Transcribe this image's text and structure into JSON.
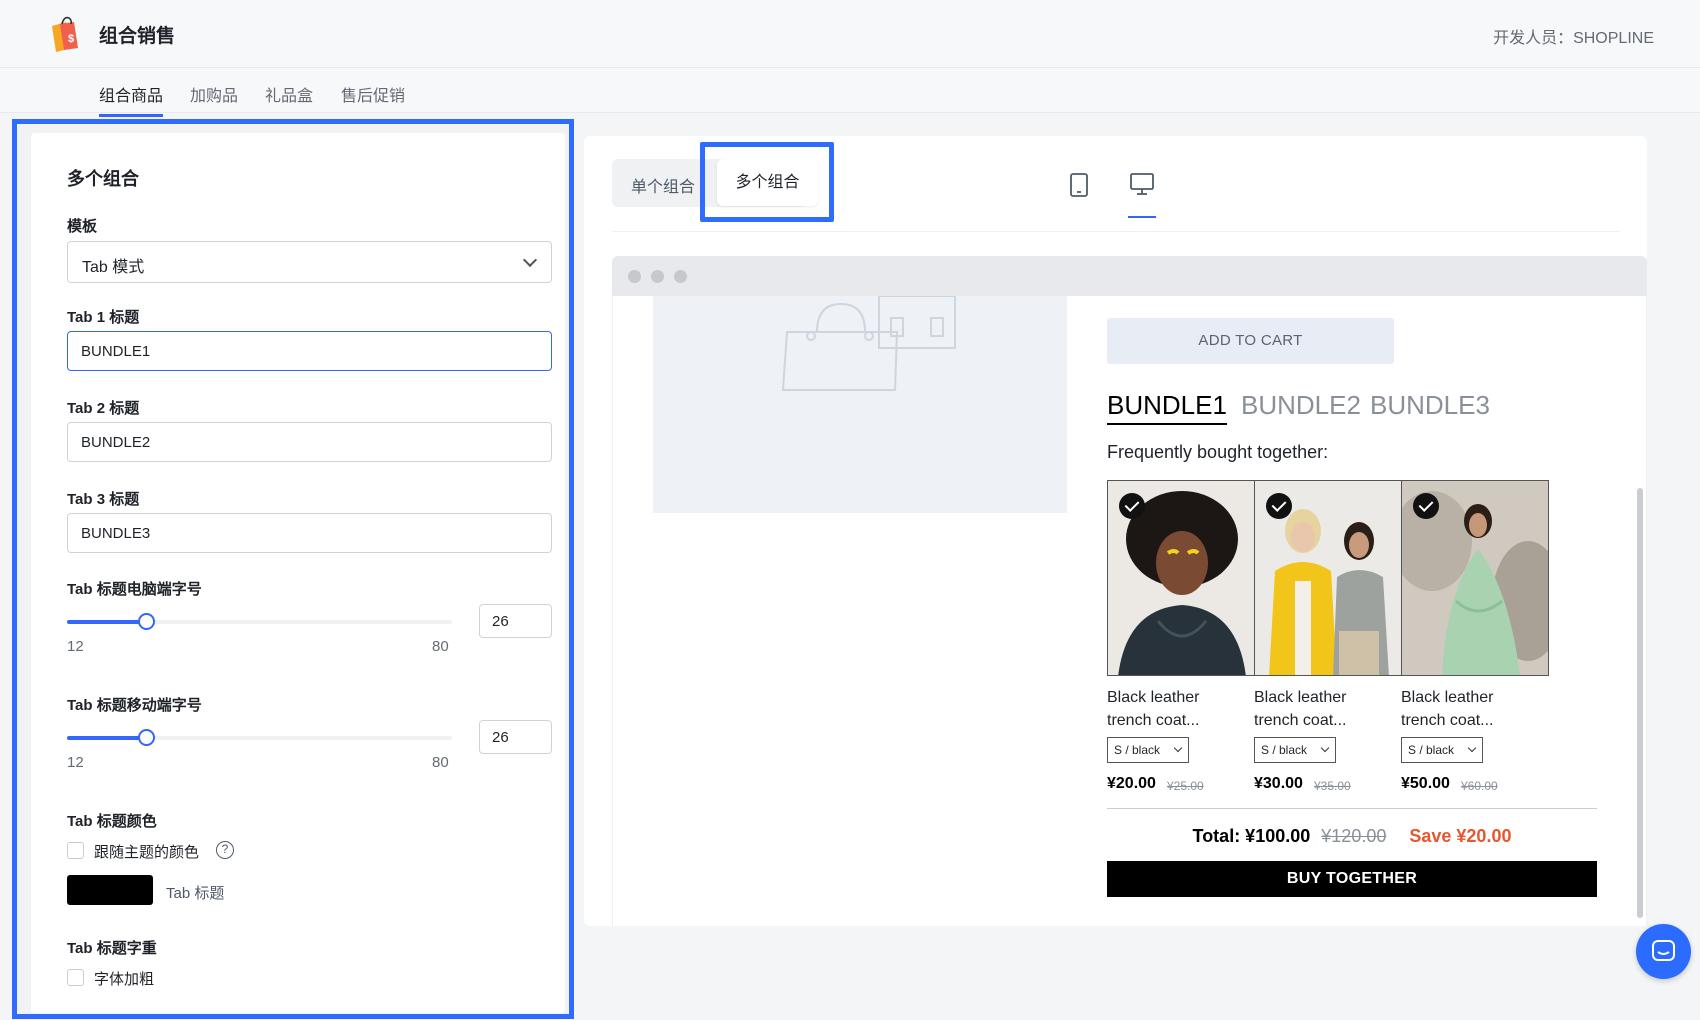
{
  "header": {
    "app_title": "组合销售",
    "developer": "开发人员：SHOPLINE"
  },
  "nav": {
    "tabs": [
      {
        "label": "组合商品",
        "active": true
      },
      {
        "label": "加购品",
        "active": false
      },
      {
        "label": "礼品盒",
        "active": false
      },
      {
        "label": "售后促销",
        "active": false
      }
    ]
  },
  "settings": {
    "title": "多个组合",
    "template": {
      "label": "模板",
      "value": "Tab 模式"
    },
    "tab1": {
      "label": "Tab 1 标题",
      "value": "BUNDLE1"
    },
    "tab2": {
      "label": "Tab 2 标题",
      "value": "BUNDLE2"
    },
    "tab3": {
      "label": "Tab 3 标题",
      "value": "BUNDLE3"
    },
    "desktop_size": {
      "label": "Tab 标题电脑端字号",
      "min": "12",
      "max": "80",
      "value": "26"
    },
    "mobile_size": {
      "label": "Tab 标题移动端字号",
      "min": "12",
      "max": "80",
      "value": "26"
    },
    "color": {
      "label": "Tab 标题颜色",
      "follow_theme_label": "跟随主题的颜色",
      "swatch_label": "Tab 标题",
      "swatch_color": "#000000",
      "follow_theme_checked": false
    },
    "weight": {
      "label": "Tab 标题字重",
      "bold_label": "字体加粗",
      "bold_checked": false
    }
  },
  "preview": {
    "mode_tabs": {
      "single": "单个组合",
      "multi": "多个组合",
      "selected": "multi"
    },
    "device": {
      "selected": "desktop"
    },
    "add_to_cart": "ADD TO CART",
    "bundle_tabs": [
      "BUNDLE1",
      "BUNDLE2",
      "BUNDLE3"
    ],
    "active_bundle": 0,
    "fbt": "Frequently bought together:",
    "products": [
      {
        "name_line1": "Black leather",
        "name_line2": "trench coat...",
        "variant": "S / black",
        "price": "¥20.00",
        "orig": "¥25.00"
      },
      {
        "name_line1": "Black leather",
        "name_line2": "trench coat...",
        "variant": "S / black",
        "price": "¥30.00",
        "orig": "¥35.00"
      },
      {
        "name_line1": "Black leather",
        "name_line2": "trench coat...",
        "variant": "S / black",
        "price": "¥50.00",
        "orig": "¥60.00"
      }
    ],
    "total_label": "Total: ¥100.00",
    "total_orig": "¥120.00",
    "save": "Save ¥20.00",
    "buy_together": "BUY TOGETHER"
  },
  "colors": {
    "accent": "#3366ff",
    "highlight": "#2f6bff",
    "save": "#e8562f"
  },
  "icons": [
    "shopping-bag-logo-icon",
    "chevron-down-icon",
    "help-icon",
    "tablet-icon",
    "desktop-icon",
    "check-icon",
    "bag-placeholder-icon",
    "arrow-left-icon",
    "chat-icon"
  ]
}
